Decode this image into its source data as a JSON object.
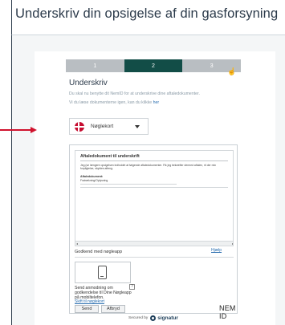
{
  "page": {
    "title": "Underskriv din opsigelse af din gasforsyning"
  },
  "colors": {
    "accent": "#124d47",
    "arrow": "#d0122d",
    "link": "#2b6fb0"
  },
  "steps": [
    {
      "label": "1",
      "state": "done"
    },
    {
      "label": "2",
      "state": "active"
    },
    {
      "label": "3",
      "state": "pending"
    }
  ],
  "sign": {
    "heading": "Underskriv",
    "description": "Du skal nu benytte dit NemID for at underskrive dine aftaledokumenter.",
    "description2": "Vi du læse dokumenterne igen, kan du klikke",
    "description2_link": "her",
    "method_label": "Nøglekort",
    "method_icon": "danish-flag-icon"
  },
  "nemid": {
    "document_title": "Aftaledokument til underskrift",
    "document_text": "Jeg (se længere opsigelsen indholdet at følgende aftaledokumenter. Fik jeg bekræfter dermed aftalen, rit der min forpligtelse, skyldes afteng.",
    "document_sub": "Aftaledokument:",
    "document_sub2": "Fratrækning/Oplysning",
    "approve_label": "Godkend med nøgleapp",
    "help_link": "Hjælp",
    "send_text": "Send anmodning om godkendelse til Dine Nøgleapp på mobiltelefon.",
    "qmark": "?",
    "switch_link": "Skift til nøglekort",
    "send_button": "Send",
    "cancel_button": "Afbryd",
    "logo": "NEM ID",
    "scroll_left": "◂",
    "scroll_right": "▸"
  },
  "footer": {
    "secured_by": "Secured by",
    "brand": "signatur"
  }
}
